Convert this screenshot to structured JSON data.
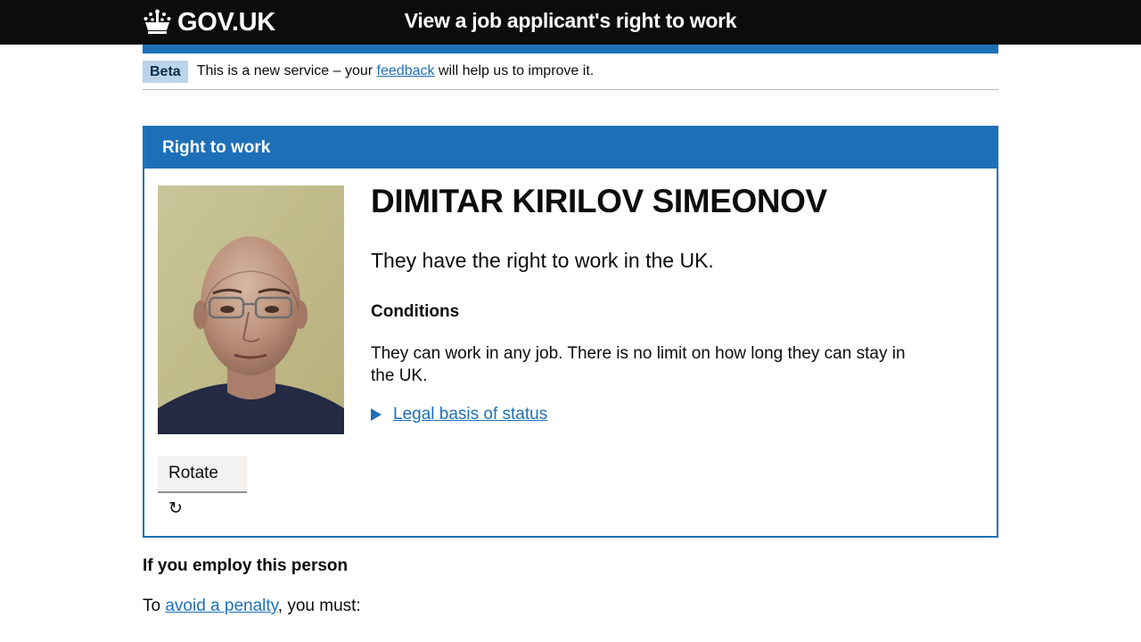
{
  "header": {
    "logo_text": "GOV.UK",
    "service_name": "View a job applicant's right to work"
  },
  "phase_banner": {
    "tag": "Beta",
    "text_before": "This is a new service – your ",
    "link": "feedback",
    "text_after": " will help us to improve it."
  },
  "panel": {
    "title": "Right to work",
    "name": "DIMITAR KIRILOV SIMEONOV",
    "status": "They have the right to work in the UK.",
    "conditions_heading": "Conditions",
    "conditions_text": "They can work in any job. There is no limit on how long they can stay in the UK.",
    "details_summary": "Legal basis of status",
    "rotate_label": "Rotate ↻"
  },
  "employ": {
    "heading": "If you employ this person",
    "text_before": "To ",
    "link": "avoid a penalty",
    "text_after": ", you must:"
  },
  "colors": {
    "header_bg": "#0b0c0c",
    "brand_blue": "#1d70b8",
    "link": "#1d70b8",
    "tag_bg": "#bbd4ea"
  }
}
